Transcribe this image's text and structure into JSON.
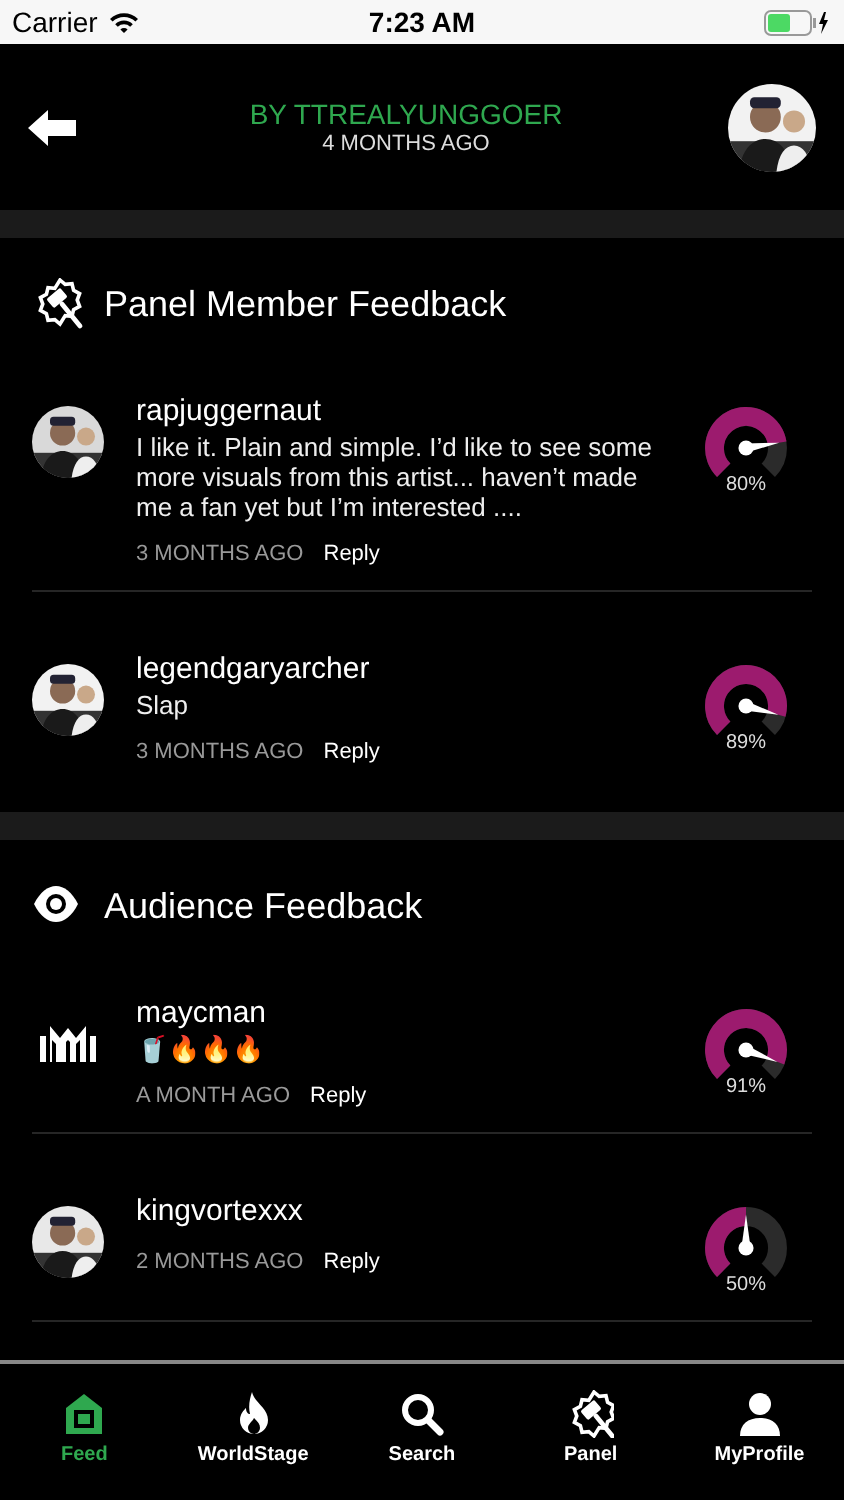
{
  "status_bar": {
    "carrier": "Carrier",
    "time": "7:23 AM"
  },
  "header": {
    "title": "BY TTREALYUNGGOER",
    "subtitle": "4 MONTHS AGO"
  },
  "sections": [
    {
      "kind": "panel",
      "title": "Panel Member Feedback",
      "comments": [
        {
          "kind": "picture",
          "user": "rapjuggernaut",
          "text": "I like it. Plain and simple. I’d like to see some more visuals from this artist... haven’t made me a fan yet but I’m interested ....",
          "time": "3 MONTHS AGO",
          "reply": "Reply",
          "reading": "80%"
        },
        {
          "kind": "picture",
          "user": "legendgaryarcher",
          "text": "Slap",
          "time": "3 MONTHS AGO",
          "reply": "Reply",
          "reading": "89%"
        }
      ]
    },
    {
      "kind": "audience",
      "title": "Audience Feedback",
      "comments": [
        {
          "kind": "monogram",
          "user": "maycman",
          "text": "🥤🔥🔥🔥",
          "time": "A MONTH AGO",
          "reply": "Reply",
          "reading": "91%"
        },
        {
          "kind": "picture",
          "user": "kingvortexxx",
          "time": "2 MONTHS AGO",
          "reply": "Reply",
          "reading": "50%"
        }
      ]
    }
  ],
  "tab_bar": [
    {
      "kind": "home",
      "label": "Feed",
      "selected": true
    },
    {
      "kind": "flame",
      "label": "WorldStage",
      "selected": false
    },
    {
      "kind": "search",
      "label": "Search",
      "selected": false
    },
    {
      "kind": "panel",
      "label": "Panel",
      "selected": false
    },
    {
      "kind": "person",
      "label": "MyProfile",
      "selected": false
    }
  ]
}
